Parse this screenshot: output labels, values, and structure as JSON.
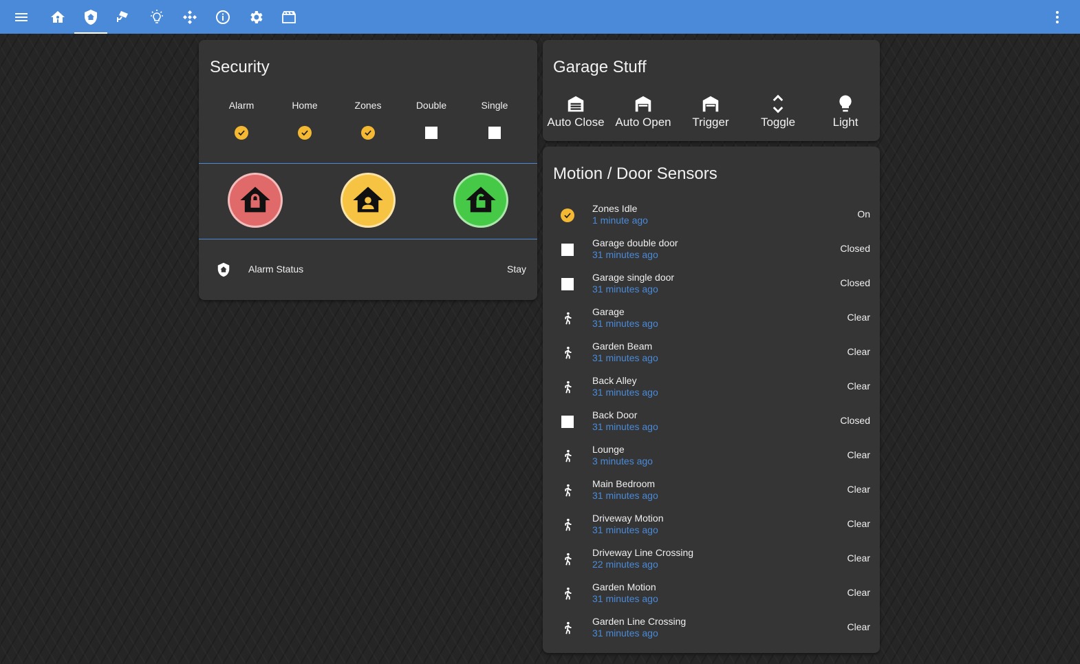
{
  "toolbar": {
    "tabs": [
      {
        "icon": "menu-icon"
      },
      {
        "icon": "home-icon"
      },
      {
        "icon": "shield-home-icon"
      },
      {
        "icon": "cctv-icon"
      },
      {
        "icon": "lightbulb-icon"
      },
      {
        "icon": "kodi-icon"
      },
      {
        "icon": "info-icon"
      },
      {
        "icon": "gear-icon"
      },
      {
        "icon": "movie-icon"
      }
    ],
    "overflow_icon": "dots-vertical-icon"
  },
  "security": {
    "title": "Security",
    "columns": [
      {
        "label": "Alarm",
        "state": "on"
      },
      {
        "label": "Home",
        "state": "on"
      },
      {
        "label": "Zones",
        "state": "on"
      },
      {
        "label": "Double",
        "state": "off"
      },
      {
        "label": "Single",
        "state": "off"
      }
    ],
    "arm_buttons": [
      {
        "icon": "home-lock-icon",
        "color": "#e06a6a"
      },
      {
        "icon": "home-account-icon",
        "color": "#f6c342"
      },
      {
        "icon": "home-lock-open-icon",
        "color": "#45c946"
      }
    ],
    "status": {
      "label": "Alarm Status",
      "value": "Stay",
      "icon": "shield-home-icon"
    }
  },
  "garage": {
    "title": "Garage Stuff",
    "buttons": [
      {
        "label": "Auto Close",
        "icon": "garage-closed-icon"
      },
      {
        "label": "Auto Open",
        "icon": "garage-icon"
      },
      {
        "label": "Trigger",
        "icon": "garage-icon"
      },
      {
        "label": "Toggle",
        "icon": "unfold-icon"
      },
      {
        "label": "Light",
        "icon": "lightbulb-icon"
      }
    ]
  },
  "sensors": {
    "title": "Motion / Door Sensors",
    "rows": [
      {
        "name": "Zones Idle",
        "time": "1 minute ago",
        "state": "On",
        "icon": "check-circle-icon"
      },
      {
        "name": "Garage double door",
        "time": "31 minutes ago",
        "state": "Closed",
        "icon": "door-square-icon"
      },
      {
        "name": "Garage single door",
        "time": "31 minutes ago",
        "state": "Closed",
        "icon": "door-square-icon"
      },
      {
        "name": "Garage",
        "time": "31 minutes ago",
        "state": "Clear",
        "icon": "walk-icon"
      },
      {
        "name": "Garden Beam",
        "time": "31 minutes ago",
        "state": "Clear",
        "icon": "walk-icon"
      },
      {
        "name": "Back Alley",
        "time": "31 minutes ago",
        "state": "Clear",
        "icon": "walk-icon"
      },
      {
        "name": "Back Door",
        "time": "31 minutes ago",
        "state": "Closed",
        "icon": "door-square-icon"
      },
      {
        "name": "Lounge",
        "time": "3 minutes ago",
        "state": "Clear",
        "icon": "walk-icon"
      },
      {
        "name": "Main Bedroom",
        "time": "31 minutes ago",
        "state": "Clear",
        "icon": "walk-icon"
      },
      {
        "name": "Driveway Motion",
        "time": "31 minutes ago",
        "state": "Clear",
        "icon": "walk-icon"
      },
      {
        "name": "Driveway Line Crossing",
        "time": "22 minutes ago",
        "state": "Clear",
        "icon": "walk-icon"
      },
      {
        "name": "Garden Motion",
        "time": "31 minutes ago",
        "state": "Clear",
        "icon": "walk-icon"
      },
      {
        "name": "Garden Line Crossing",
        "time": "31 minutes ago",
        "state": "Clear",
        "icon": "walk-icon"
      }
    ]
  },
  "colors": {
    "accent": "#4a8ad8",
    "card": "#353535",
    "check": "#f4b833"
  }
}
